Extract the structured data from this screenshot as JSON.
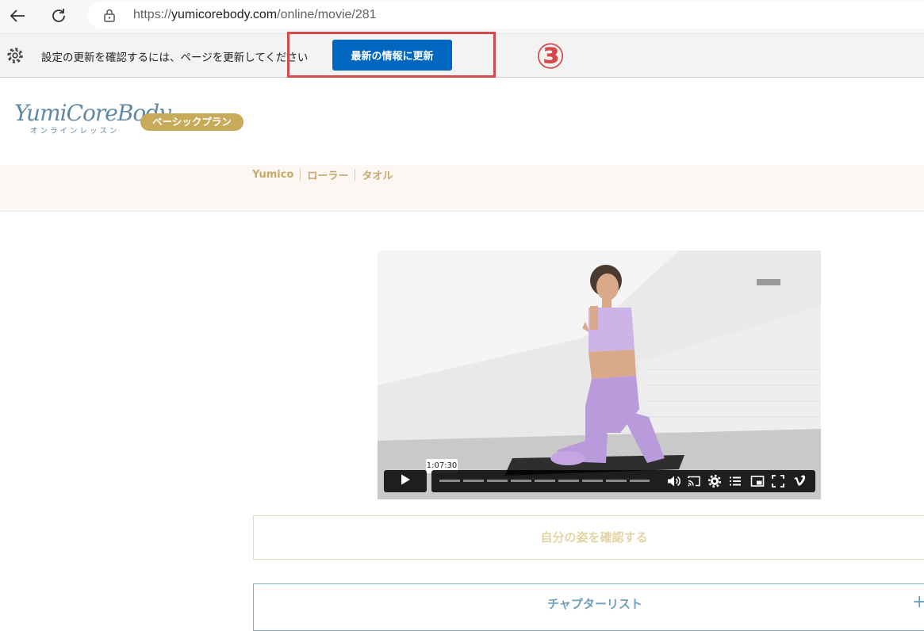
{
  "browser": {
    "url_prefix": "https://",
    "url_host": "yumicorebody.com",
    "url_path": "/online/movie/281"
  },
  "infobar": {
    "message": "設定の更新を確認するには、ページを更新してください",
    "refresh_button_label": "最新の情報に更新",
    "step_marker": "③"
  },
  "site": {
    "logo_text": "YumiCoreBody",
    "logo_subtitle": "オンラインレッスン",
    "plan_badge": "ベーシックプラン",
    "tags": [
      "Yumico",
      "ローラー",
      "タオル"
    ]
  },
  "video": {
    "time_tooltip": "1:07:30",
    "controls": [
      "play-icon",
      "volume-icon",
      "cast-icon",
      "settings-icon",
      "chapters-icon",
      "pip-icon",
      "fullscreen-icon",
      "vimeo-icon"
    ]
  },
  "actions": {
    "self_check_label": "自分の姿を確認する",
    "chapter_list_label": "チャプターリスト",
    "chapter_list_toggle": "+"
  },
  "colors": {
    "accent_red": "#d34a4a",
    "edge_blue": "#0067c0",
    "gold": "#c7ab5a",
    "logo_blue": "#5f88a4"
  }
}
